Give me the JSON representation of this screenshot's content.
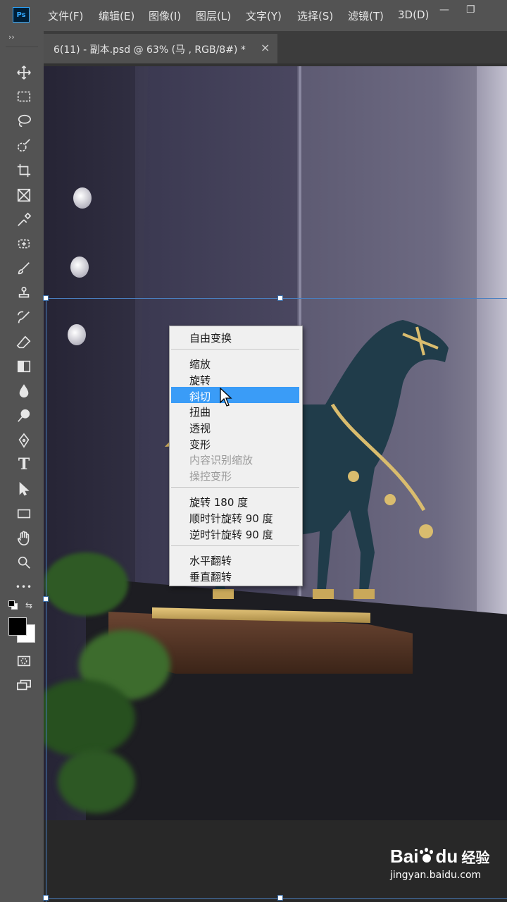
{
  "app": {
    "logo_text": "Ps"
  },
  "menubar": {
    "items": [
      "文件(F)",
      "编辑(E)",
      "图像(I)",
      "图层(L)",
      "文字(Y)",
      "选择(S)",
      "滤镜(T)",
      "3D(D)"
    ]
  },
  "window_controls": {
    "minimize": "—",
    "restore": "❐"
  },
  "tab": {
    "title": "6(11) - 副本.psd @ 63% (马 , RGB/8#) *",
    "close": "×"
  },
  "toolbar": {
    "collapse_label": "››",
    "tools": [
      "move-icon",
      "marquee-icon",
      "lasso-icon",
      "quick-select-icon",
      "crop-icon",
      "frame-icon",
      "eyedropper-icon",
      "healing-brush-icon",
      "brush-icon",
      "clone-stamp-icon",
      "history-brush-icon",
      "eraser-icon",
      "gradient-icon",
      "blur-icon",
      "dodge-icon",
      "pen-icon",
      "type-icon",
      "path-select-icon",
      "rectangle-icon",
      "hand-icon",
      "zoom-icon",
      "more-icon"
    ],
    "type_tool_label": "T",
    "more_label": "•••"
  },
  "colors": {
    "foreground": "#000000",
    "background": "#ffffff",
    "highlight": "#3a9cf7",
    "ps_blue": "#31a8ff"
  },
  "context_menu": {
    "groups": [
      [
        {
          "label": "自由变换",
          "enabled": true
        }
      ],
      [
        {
          "label": "缩放",
          "enabled": true
        },
        {
          "label": "旋转",
          "enabled": true
        },
        {
          "label": "斜切",
          "enabled": true,
          "highlighted": true
        },
        {
          "label": "扭曲",
          "enabled": true
        },
        {
          "label": "透视",
          "enabled": true
        },
        {
          "label": "变形",
          "enabled": true
        },
        {
          "label": "内容识别缩放",
          "enabled": false
        },
        {
          "label": "操控变形",
          "enabled": false
        }
      ],
      [
        {
          "label": "旋转 180 度",
          "enabled": true
        },
        {
          "label": "顺时针旋转 90 度",
          "enabled": true
        },
        {
          "label": "逆时针旋转 90 度",
          "enabled": true
        }
      ],
      [
        {
          "label": "水平翻转",
          "enabled": true
        },
        {
          "label": "垂直翻转",
          "enabled": true
        }
      ]
    ]
  },
  "watermark": {
    "brand": "Bai",
    "brand2": "du",
    "cn": "经验",
    "url": "jingyan.baidu.com"
  }
}
